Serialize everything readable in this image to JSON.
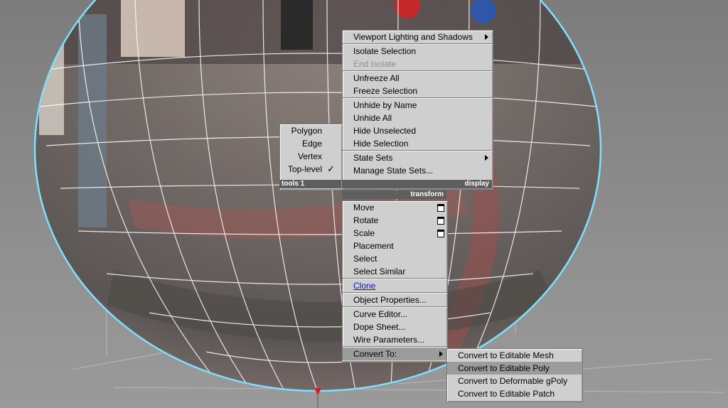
{
  "quad_menu": {
    "display": {
      "header": "display",
      "items": [
        {
          "label": "Viewport Lighting and Shadows",
          "submenu": true
        },
        {
          "sep": true
        },
        {
          "label": "Isolate Selection"
        },
        {
          "label": "End Isolate",
          "disabled": true
        },
        {
          "sep": true
        },
        {
          "label": "Unfreeze All"
        },
        {
          "label": "Freeze Selection"
        },
        {
          "sep": true
        },
        {
          "label": "Unhide by Name"
        },
        {
          "label": "Unhide All"
        },
        {
          "label": "Hide Unselected"
        },
        {
          "label": "Hide Selection"
        },
        {
          "sep": true
        },
        {
          "label": "State Sets",
          "submenu": true
        },
        {
          "label": "Manage State Sets..."
        }
      ]
    },
    "tools1": {
      "header": "tools 1",
      "items": [
        {
          "label": "Polygon"
        },
        {
          "label": "Edge"
        },
        {
          "label": "Vertex"
        },
        {
          "label": "Top-level",
          "checked": true
        }
      ],
      "check_glyph": "✓"
    },
    "transform": {
      "header": "transform",
      "items": [
        {
          "label": "Move",
          "option": true
        },
        {
          "label": "Rotate",
          "option": true
        },
        {
          "label": "Scale",
          "option": true
        },
        {
          "label": "Placement"
        },
        {
          "label": "Select"
        },
        {
          "label": "Select Similar"
        },
        {
          "sep": true
        },
        {
          "label": "Clone",
          "link": true
        },
        {
          "sep": true
        },
        {
          "label": "Object Properties..."
        },
        {
          "sep": true
        },
        {
          "label": "Curve Editor..."
        },
        {
          "label": "Dope Sheet..."
        },
        {
          "label": "Wire Parameters..."
        },
        {
          "sep": true
        },
        {
          "label": "Convert To:",
          "submenu": true,
          "highlighted": true
        }
      ]
    },
    "convert_submenu": {
      "items": [
        {
          "label": "Convert to Editable Mesh"
        },
        {
          "label": "Convert to Editable Poly",
          "highlighted": true
        },
        {
          "label": "Convert to Deformable gPoly"
        },
        {
          "label": "Convert to Editable Patch"
        }
      ]
    }
  },
  "colors": {
    "menu_bg": "#cfcfcf",
    "header_bg": "#5e5e5e",
    "highlight": "#9c9c9c",
    "sphere_outline": "#7fe0ff",
    "wireframe": "#ffffff"
  }
}
